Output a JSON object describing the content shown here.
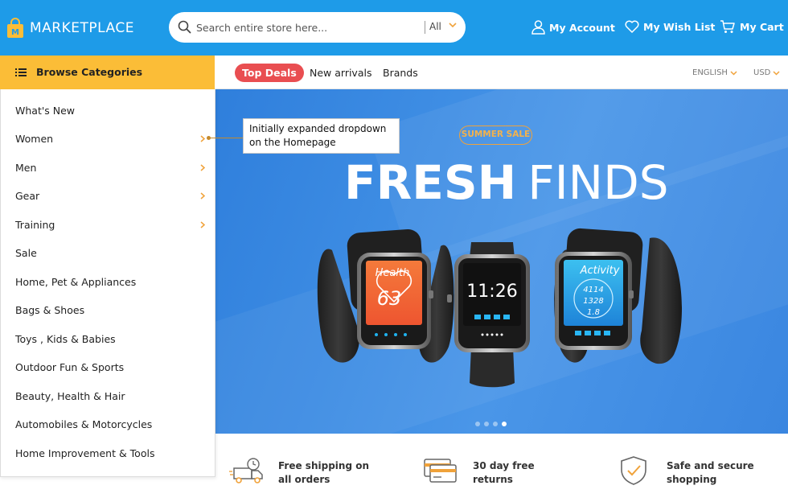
{
  "header": {
    "logo_text": "MARKETPLACE",
    "logo_letter": "M",
    "search": {
      "placeholder": "Search entire store here...",
      "category": "All"
    },
    "account_label": "My Account",
    "wishlist_label": "My Wish List",
    "cart_label": "My Cart"
  },
  "nav": {
    "browse_label": "Browse Categories",
    "top_deals_label": "Top Deals",
    "links": [
      "New arrivals",
      "Brands"
    ],
    "language": "ENGLISH",
    "currency": "USD"
  },
  "categories": [
    {
      "label": "What's New",
      "has_submenu": false
    },
    {
      "label": "Women",
      "has_submenu": true
    },
    {
      "label": "Men",
      "has_submenu": true
    },
    {
      "label": "Gear",
      "has_submenu": true
    },
    {
      "label": "Training",
      "has_submenu": true
    },
    {
      "label": "Sale",
      "has_submenu": false
    },
    {
      "label": "Home, Pet & Appliances",
      "has_submenu": false
    },
    {
      "label": "Bags & Shoes",
      "has_submenu": false
    },
    {
      "label": "Toys , Kids & Babies",
      "has_submenu": false
    },
    {
      "label": "Outdoor Fun & Sports",
      "has_submenu": false
    },
    {
      "label": "Beauty, Health & Hair",
      "has_submenu": false
    },
    {
      "label": "Automobiles & Motorcycles",
      "has_submenu": false
    },
    {
      "label": "Home Improvement & Tools",
      "has_submenu": false
    }
  ],
  "callout": {
    "line1": "Initially expanded dropdown",
    "line2": "on the Homepage"
  },
  "banner": {
    "badge": "SUMMER SALE",
    "headline_bold": "FRESH",
    "headline_light": "FINDS",
    "watch_left": {
      "title": "Health",
      "value": "63"
    },
    "watch_center": {
      "time": "11:26"
    },
    "watch_right": {
      "title": "Activity",
      "line1": "4114",
      "line2": "1328",
      "line3": "1.8"
    },
    "slide_count": 4,
    "active_slide": 4
  },
  "features": [
    {
      "line1": "Free shipping on",
      "line2": "all orders",
      "icon": "delivery-truck-icon"
    },
    {
      "line1": "30 day free",
      "line2": "returns",
      "icon": "credit-card-icon"
    },
    {
      "line1": "Safe and secure",
      "line2": "shopping",
      "icon": "shield-check-icon"
    }
  ],
  "colors": {
    "header_blue": "#1e9be8",
    "accent_yellow": "#fbbd37",
    "deal_red": "#e94e51",
    "banner_blue": "#3f8ee4",
    "chevron_orange": "#f0a23a"
  }
}
